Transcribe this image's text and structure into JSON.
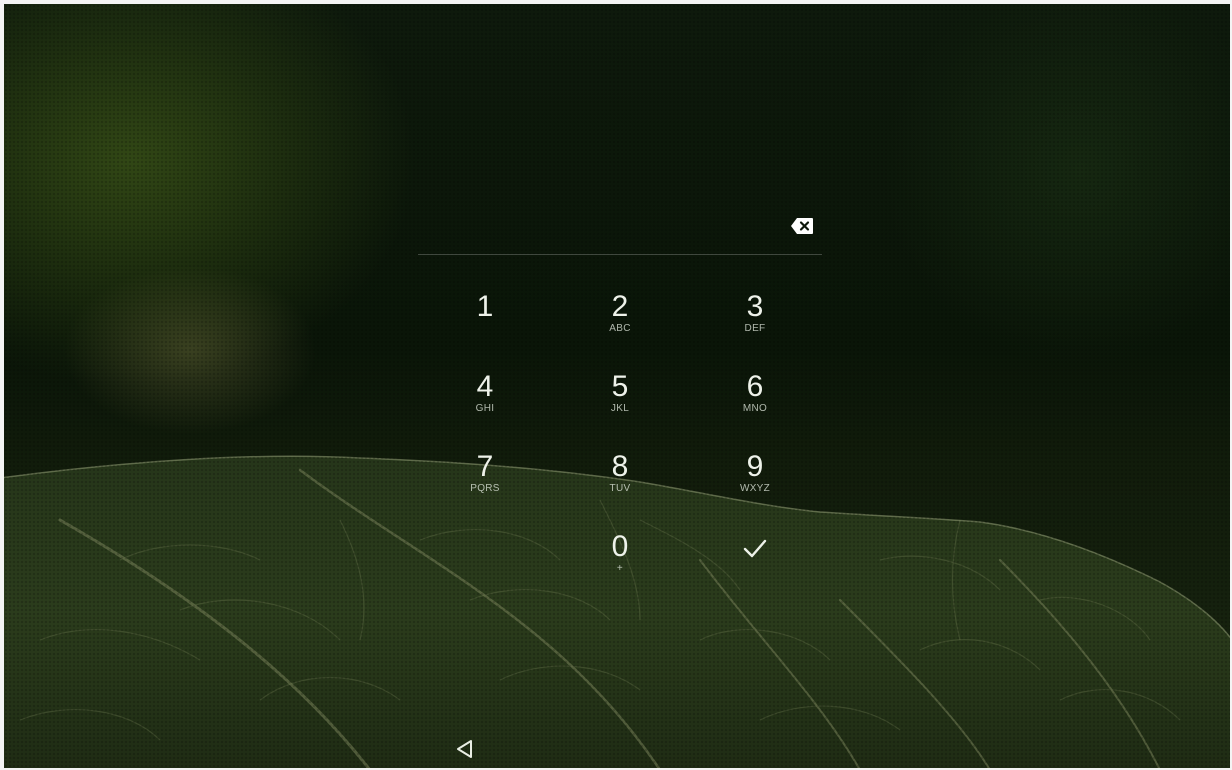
{
  "keypad": {
    "keys": [
      {
        "digit": "1",
        "letters": ""
      },
      {
        "digit": "2",
        "letters": "ABC"
      },
      {
        "digit": "3",
        "letters": "DEF"
      },
      {
        "digit": "4",
        "letters": "GHI"
      },
      {
        "digit": "5",
        "letters": "JKL"
      },
      {
        "digit": "6",
        "letters": "MNO"
      },
      {
        "digit": "7",
        "letters": "PQRS"
      },
      {
        "digit": "8",
        "letters": "TUV"
      },
      {
        "digit": "9",
        "letters": "WXYZ"
      },
      {
        "digit": "0",
        "letters": "+"
      }
    ],
    "enter_icon": "checkmark-icon",
    "delete_icon": "backspace-icon"
  },
  "pin_entry": {
    "value": ""
  },
  "navigation": {
    "back_icon": "back-triangle-icon"
  },
  "wallpaper": {
    "subject": "leaf",
    "accent": "#2d4a18"
  }
}
